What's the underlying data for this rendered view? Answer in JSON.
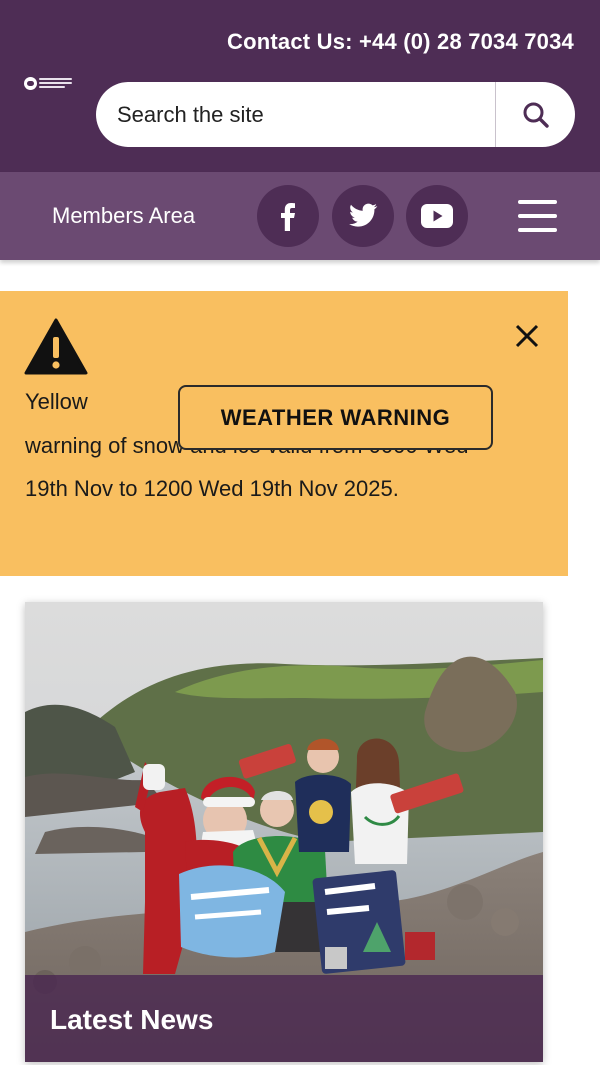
{
  "header": {
    "contact": "Contact Us: +44 (0) 28 7034 7034",
    "logo_icon": "council-logo",
    "search": {
      "placeholder": "Search the site",
      "icon": "search-icon"
    },
    "colors": {
      "primary": "#4e2d55",
      "nav": "#6b4a72"
    }
  },
  "nav": {
    "members_label": "Members Area",
    "social": [
      {
        "name": "facebook",
        "icon": "facebook-icon"
      },
      {
        "name": "twitter",
        "icon": "twitter-icon"
      },
      {
        "name": "youtube",
        "icon": "youtube-icon"
      }
    ],
    "menu_icon": "hamburger-menu-icon"
  },
  "alert": {
    "color": "#f9bf60",
    "icon": "warning-triangle-icon",
    "close_icon": "close-icon",
    "text_line1": "Yellow",
    "text_rest": "warning of snow and ice valid from 0000 Wed 19th Nov to 1200 Wed 19th Nov 2025.",
    "button_label": "WEATHER WARNING"
  },
  "news": {
    "label": "Latest News"
  }
}
